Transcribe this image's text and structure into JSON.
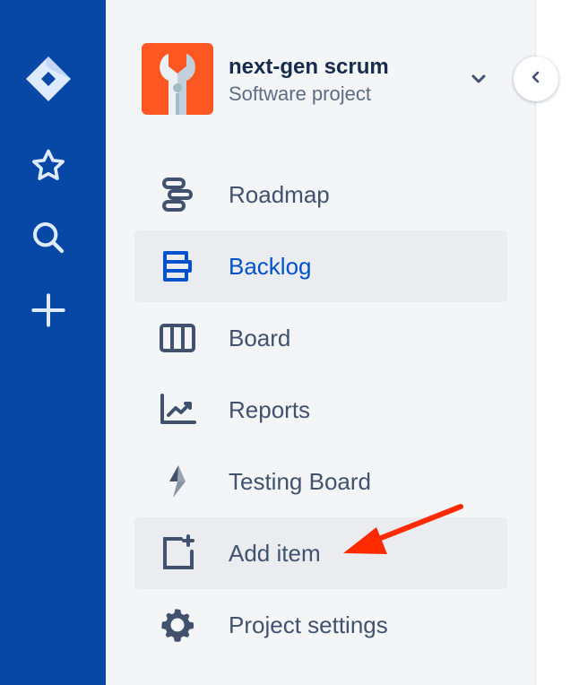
{
  "project": {
    "name": "next-gen scrum",
    "type": "Software project"
  },
  "nav": [
    {
      "label": "Roadmap",
      "icon": "roadmap-icon"
    },
    {
      "label": "Backlog",
      "icon": "backlog-icon",
      "active": true
    },
    {
      "label": "Board",
      "icon": "board-icon"
    },
    {
      "label": "Reports",
      "icon": "reports-icon"
    },
    {
      "label": "Testing Board",
      "icon": "lightning-icon"
    },
    {
      "label": "Add item",
      "icon": "add-item-icon",
      "highlighted": true
    },
    {
      "label": "Project settings",
      "icon": "gear-icon"
    }
  ],
  "colors": {
    "rail": "#0747a6",
    "active": "#0052cc",
    "annotation": "#ff2a00"
  }
}
